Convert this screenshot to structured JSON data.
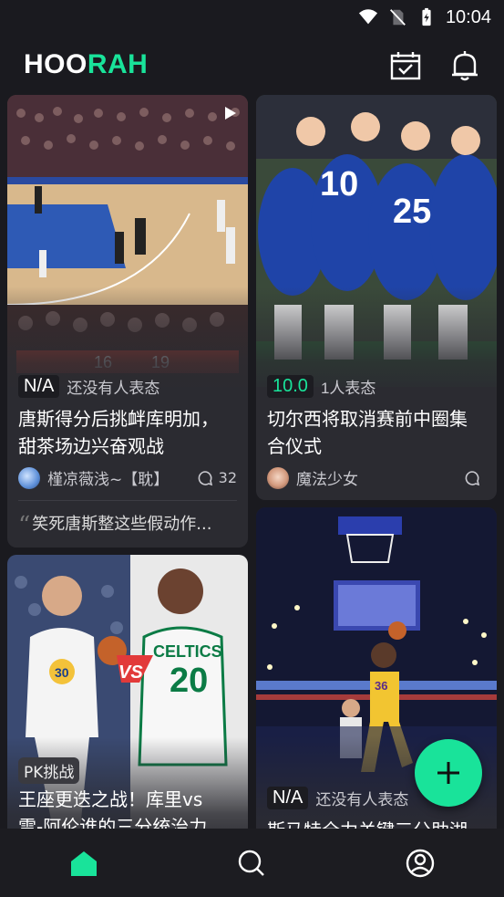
{
  "status_bar": {
    "time": "10:04"
  },
  "app": {
    "logo_part1": "HOO",
    "logo_part2": "RAH",
    "accent": "#19e39a"
  },
  "header_icons": [
    "calendar-check-icon",
    "bell-icon"
  ],
  "cards": [
    {
      "rating": "N/A",
      "rating_label": "还没有人表态",
      "title_line1": "唐斯得分后挑衅库明加，",
      "title_line2": "甜茶场边兴奋观战",
      "author": "槿凉薇浅~【耽】",
      "comments": "32",
      "quote": "笑死唐斯整这些假动作...",
      "media": "video"
    },
    {
      "rating": "10.0",
      "rating_label": "1人表态",
      "title_line1": "切尔西将取消赛前中圈集",
      "title_line2": "合仪式",
      "author": "魔法少女",
      "comments": ""
    },
    {
      "tag": "PK挑战",
      "title_line1": "王座更迭之战！库里vs",
      "title_line2": "雷-阿伦谁的三分统治力..."
    },
    {
      "rating": "N/A",
      "rating_label": "还没有人表态",
      "title_line1": "斯马特全力关键三分助湖"
    }
  ],
  "bottom_nav": [
    "home-icon",
    "search-icon",
    "profile-icon"
  ]
}
